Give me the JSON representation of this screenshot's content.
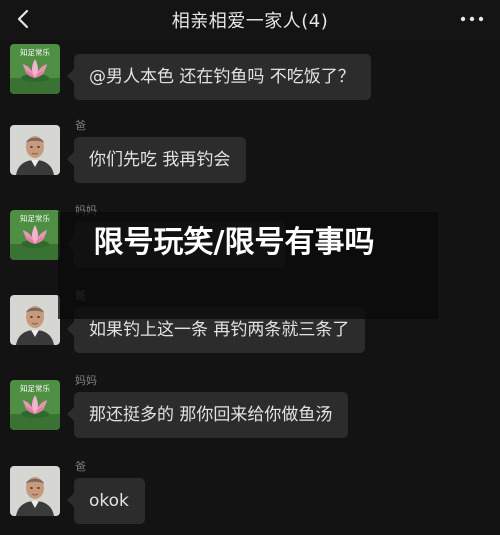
{
  "header": {
    "title": "相亲相爱一家人(4)",
    "back_icon": "back-arrow-icon",
    "more_icon": "more-dots-icon"
  },
  "avatars": {
    "mom_caption": "知足常乐",
    "mom_icon": "lotus-avatar-icon",
    "dad_icon": "man-portrait-avatar-icon"
  },
  "messages": [
    {
      "sender": "",
      "text": "@男人本色 还在钓鱼吗 不吃饭了？"
    },
    {
      "sender": "爸",
      "text": "你们先吃 我再钓会"
    },
    {
      "sender": "妈妈",
      "text": ""
    },
    {
      "sender": "爸",
      "text": "如果钓上这一条 再钓两条就三条了"
    },
    {
      "sender": "妈妈",
      "text": "那还挺多的 那你回来给你做鱼汤"
    },
    {
      "sender": "爸",
      "text": "okok"
    }
  ],
  "overlay": {
    "text": "限号玩笑/限号有事吗"
  },
  "colors": {
    "background": "#131313",
    "bubble": "#2c2c2c",
    "text": "#e2e2e2",
    "sender": "#7f7f7f"
  }
}
